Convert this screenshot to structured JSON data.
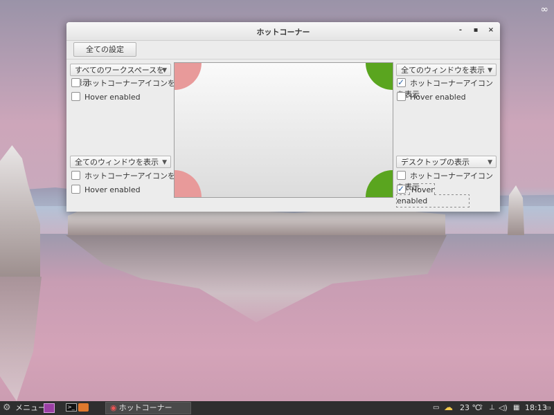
{
  "window": {
    "title": "ホットコーナー",
    "controls": {
      "minimize": "-",
      "maximize": "▪",
      "close": "×"
    },
    "toolbar": {
      "all_settings_label": "全ての設定"
    },
    "corners": {
      "top_left": {
        "action": "すべてのワークスペースを表示",
        "show_icon_label": "ホットコーナーアイコンを表示",
        "show_icon_checked": false,
        "hover_label": "Hover enabled",
        "hover_checked": false
      },
      "top_right": {
        "action": "全てのウィンドウを表示",
        "show_icon_label": "ホットコーナーアイコンを表示",
        "show_icon_checked": true,
        "hover_label": "Hover enabled",
        "hover_checked": false
      },
      "bottom_left": {
        "action": "全てのウィンドウを表示",
        "show_icon_label": "ホットコーナーアイコンを表示",
        "show_icon_checked": false,
        "hover_label": "Hover enabled",
        "hover_checked": false
      },
      "bottom_right": {
        "action": "デスクトップの表示",
        "show_icon_label": "ホットコーナーアイコンを表示",
        "show_icon_checked": false,
        "hover_label": "Hover enabled",
        "hover_checked": true
      }
    },
    "preview_colors": {
      "inactive": "#e89a9a",
      "active": "#5aa51f"
    }
  },
  "taskbar": {
    "menu_label": "メニュー",
    "window_button_label": "ホットコーナー",
    "weather": "23 ℃",
    "clock": "18:13"
  }
}
